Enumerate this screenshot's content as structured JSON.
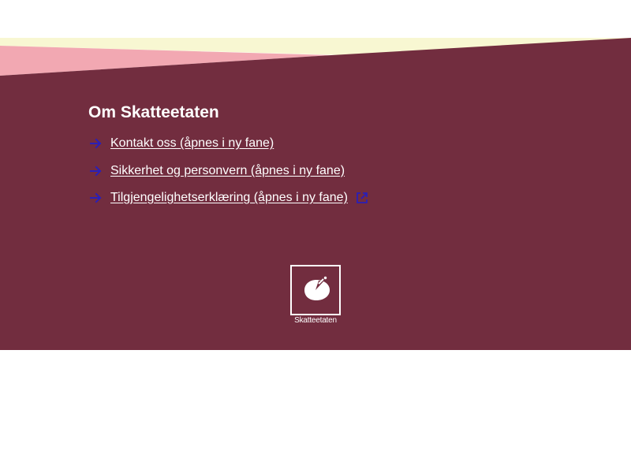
{
  "colors": {
    "footer_background": "#722d3f",
    "wave_cream": "#f8f7d2",
    "wave_pink": "#f2a8b2",
    "link_arrow": "#2a1fb8",
    "text": "#ffffff"
  },
  "footer": {
    "heading": "Om Skatteetaten",
    "links": [
      {
        "label": "Kontakt oss (åpnes i ny fane)",
        "icon": "arrow-right-icon"
      },
      {
        "label": "Sikkerhet og personvern (åpnes i ny fane)",
        "icon": "arrow-right-icon"
      },
      {
        "label": "Tilgjengelighetserklæring (åpnes i ny fane)",
        "icon": "arrow-right-icon",
        "trailing_icon": "external-link-icon"
      }
    ],
    "logo": {
      "icon": "skatteetaten-logo-icon",
      "text": "Skatteetaten"
    }
  }
}
